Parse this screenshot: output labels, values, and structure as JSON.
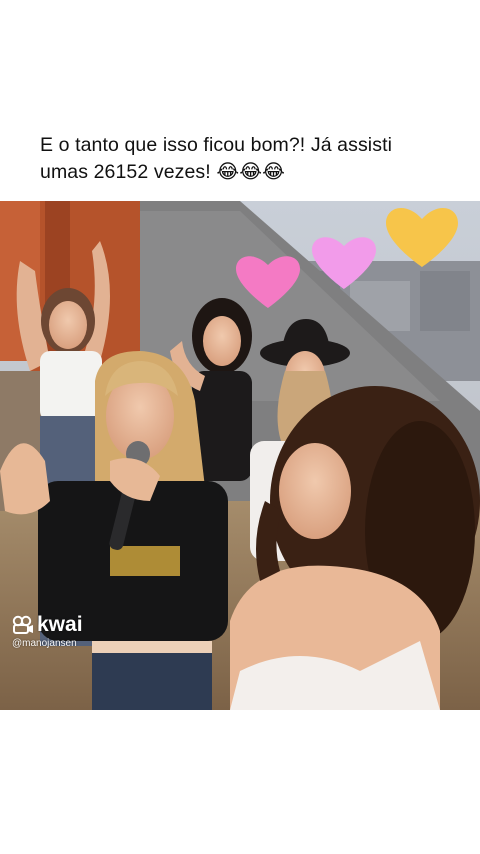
{
  "post": {
    "caption_line1": "E o tanto que isso ficou bom?! Já assisti",
    "caption_line2": "umas 26152 vezes! 😂😂😂"
  },
  "video": {
    "watermark_brand": "kwai",
    "watermark_handle": "@manojansen",
    "heart_colors": [
      "#f47ac4",
      "#f29bea",
      "#f7c54a"
    ]
  }
}
